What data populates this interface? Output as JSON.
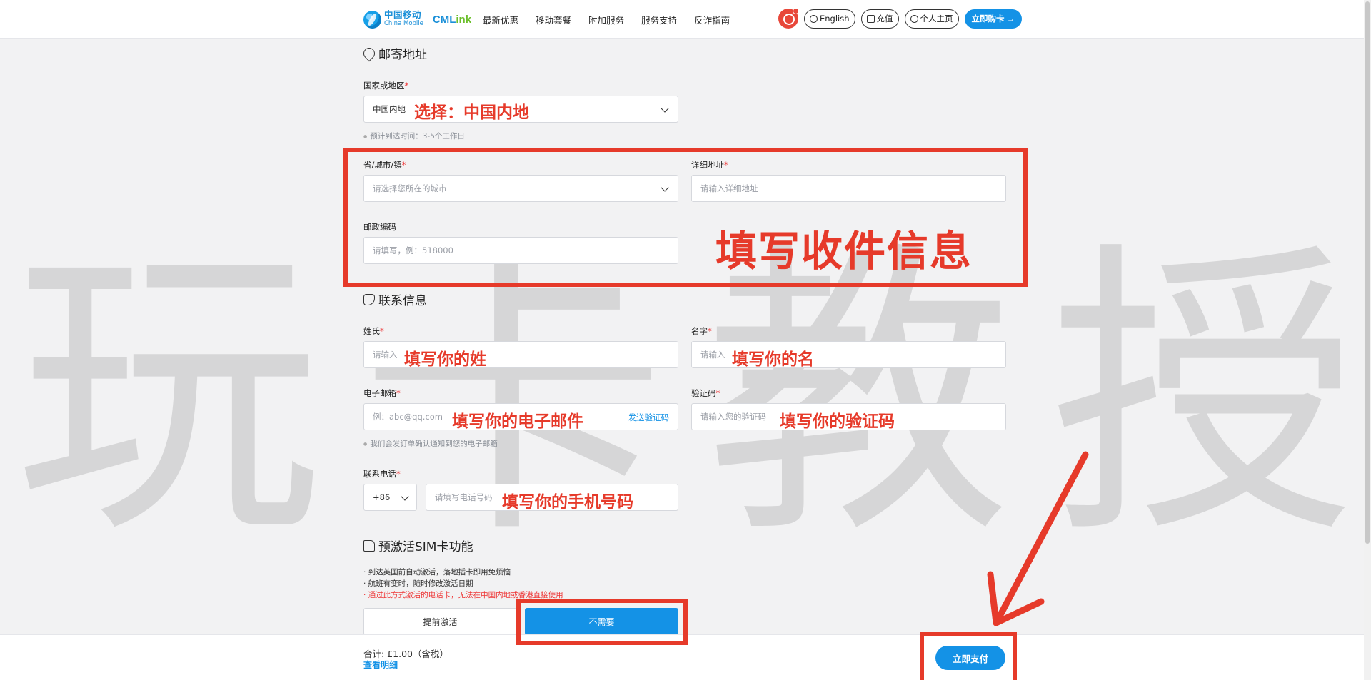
{
  "header": {
    "logo_cn": "中国移动",
    "logo_en": "China Mobile",
    "logo_brand_a": "CML",
    "logo_brand_b": "ink",
    "nav": [
      "最新优惠",
      "移动套餐",
      "附加服务",
      "服务支持",
      "反诈指南"
    ],
    "lang_label": "English",
    "recharge_label": "充值",
    "account_label": "个人主页",
    "buy_label": "立即购卡 →"
  },
  "watermark": [
    "玩",
    "卡",
    "教",
    "授"
  ],
  "mailing": {
    "title": "邮寄地址",
    "country_label": "国家或地区",
    "country_value": "中国内地",
    "country_hint": "预计到达时间：3-5个工作日",
    "city_label": "省/城市/镇",
    "city_placeholder": "请选择您所在的城市",
    "address_label": "详细地址",
    "address_placeholder": "请输入详细地址",
    "postcode_label": "邮政编码",
    "postcode_placeholder": "请填写，例：518000"
  },
  "contact": {
    "title": "联系信息",
    "surname_label": "姓氏",
    "surname_placeholder": "请输入",
    "name_label": "名字",
    "name_placeholder": "请输入",
    "email_label": "电子邮箱",
    "email_placeholder": "例：abc@qq.com",
    "send_code": "发送验证码",
    "email_hint": "我们会发订单确认通知到您的电子邮箱",
    "code_label": "验证码",
    "code_placeholder": "请输入您的验证码",
    "phone_label": "联系电话",
    "phone_code": "+86",
    "phone_placeholder": "请填写电话号码"
  },
  "sim": {
    "title": "预激活SIM卡功能",
    "bullets": [
      "· 到达英国前自动激活，落地插卡即用免烦恼",
      "· 航班有变时，随时修改激活日期"
    ],
    "warning": "· 通过此方式激活的电话卡，无法在中国内地或香港直接使用",
    "option_yes": "提前激活",
    "option_no": "不需要"
  },
  "footer": {
    "total": "合计: £1.00（含税）",
    "detail": "查看明细",
    "pay": "立即支付"
  },
  "annotations": {
    "choose_country": "选择：中国内地",
    "fill_receiver": "填写收件信息",
    "fill_surname": "填写你的姓",
    "fill_name": "填写你的名",
    "fill_email": "填写你的电子邮件",
    "fill_code": "填写你的验证码",
    "fill_phone": "填写你的手机号码"
  },
  "colors": {
    "accent": "#1492e6",
    "annotation_red": "#e63a2a",
    "required": "#e33333"
  }
}
